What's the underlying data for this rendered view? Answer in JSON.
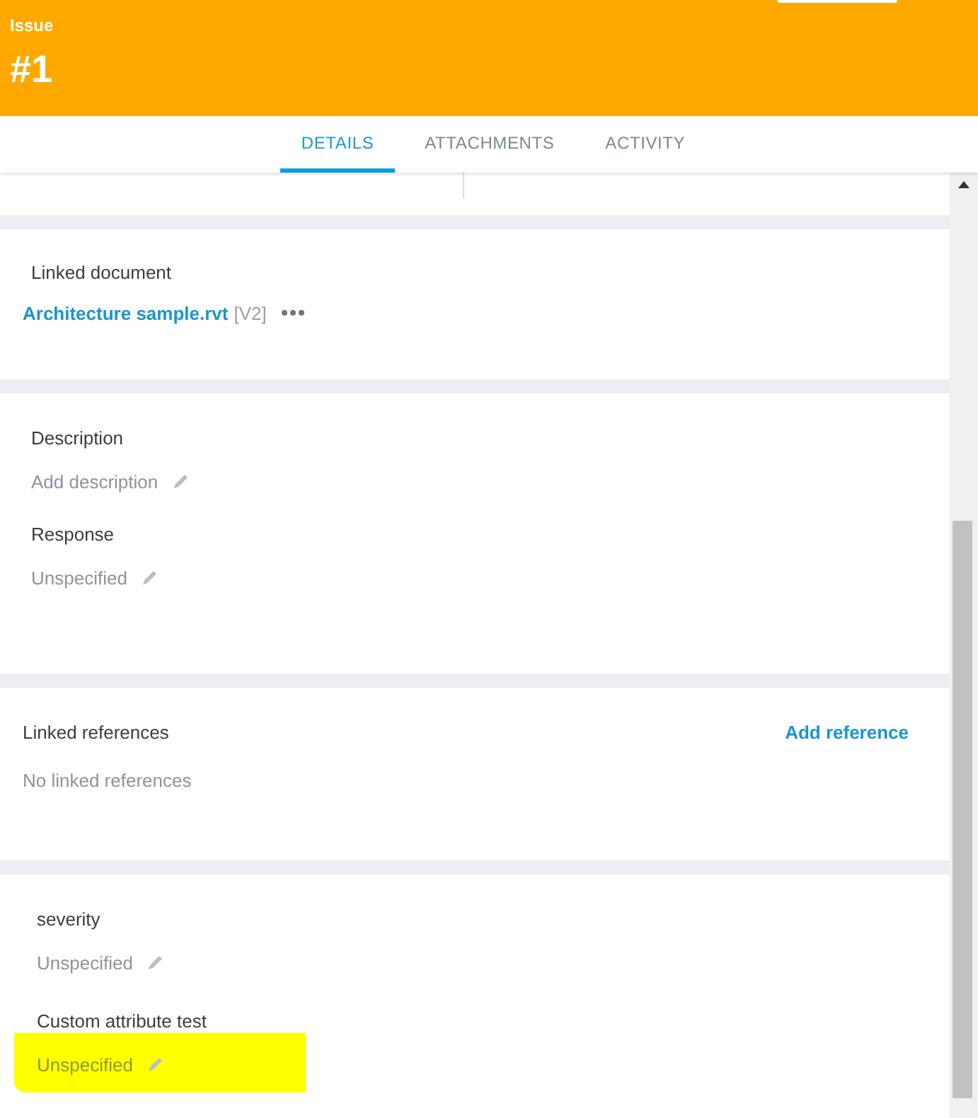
{
  "header": {
    "type_label": "Issue",
    "number": "#1"
  },
  "tabs": [
    {
      "label": "DETAILS",
      "selected": true
    },
    {
      "label": "ATTACHMENTS",
      "selected": false
    },
    {
      "label": "ACTIVITY",
      "selected": false
    }
  ],
  "linked_document": {
    "label": "Linked document",
    "file": "Architecture sample.rvt",
    "version": "[V2]"
  },
  "text_fields": [
    {
      "label": "Description",
      "value": "Add description"
    },
    {
      "label": "Response",
      "value": "Unspecified"
    }
  ],
  "linked_references": {
    "label": "Linked references",
    "action": "Add reference",
    "empty_text": "No linked references"
  },
  "custom_attributes": [
    {
      "label": "severity",
      "value": "Unspecified",
      "highlighted": false
    },
    {
      "label": "Custom attribute test",
      "value": "Unspecified",
      "highlighted": true
    }
  ]
}
